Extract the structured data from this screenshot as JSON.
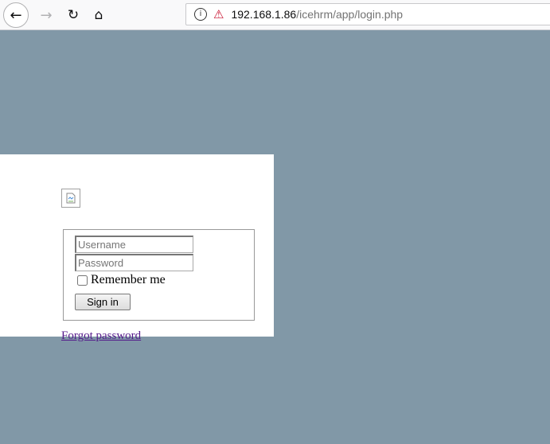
{
  "browser": {
    "url_host": "192.168.1.86",
    "url_path": "/icehrm/app/login.php",
    "back_icon": "←",
    "forward_icon": "→",
    "reload_icon": "↻",
    "home_icon": "⌂",
    "info_icon": "i",
    "insecure_icon": "⚠"
  },
  "login": {
    "username_placeholder": "Username",
    "password_placeholder": "Password",
    "remember_label": "Remember me",
    "signin_label": "Sign in",
    "forgot_label": "Forgot password"
  },
  "colors": {
    "background": "#8198a7",
    "link": "#551a8b"
  }
}
